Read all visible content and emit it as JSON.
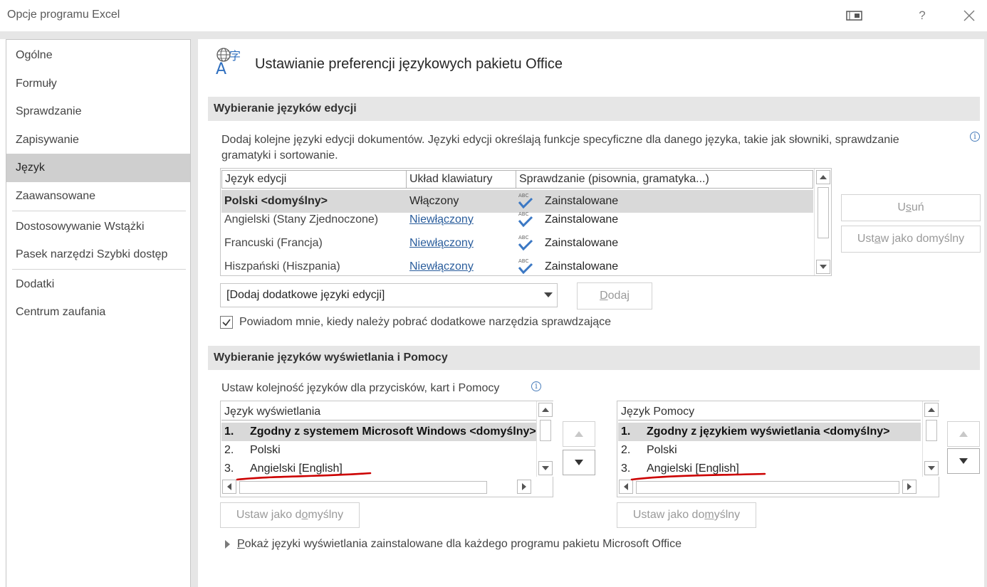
{
  "window": {
    "title": "Opcje programu Excel",
    "help_label": "?",
    "restore_icon": "restore-window-icon",
    "close_icon": "close-icon"
  },
  "sidebar": {
    "items": [
      {
        "label": "Ogólne"
      },
      {
        "label": "Formuły"
      },
      {
        "label": "Sprawdzanie"
      },
      {
        "label": "Zapisywanie"
      },
      {
        "label": "Język",
        "active": true
      },
      {
        "label": "Zaawansowane"
      },
      {
        "label": "Dostosowywanie Wstążki"
      },
      {
        "label": "Pasek narzędzi Szybki dostęp"
      },
      {
        "label": "Dodatki"
      },
      {
        "label": "Centrum zaufania"
      }
    ]
  },
  "header": {
    "title": "Ustawianie preferencji językowych pakietu Office",
    "icon": "language-icon",
    "icon_glyph_letter": "A",
    "icon_glyph_cjk": "字"
  },
  "editing": {
    "section_title": "Wybieranie języków edycji",
    "description": "Dodaj kolejne języki edycji dokumentów. Języki edycji określają funkcje specyficzne dla danego języka, takie jak słowniki, sprawdzanie gramatyki i sortowanie.",
    "info_label": "i",
    "columns": [
      "Język edycji",
      "Układ klawiatury",
      "Sprawdzanie (pisownia, gramatyka...)"
    ],
    "rows": [
      {
        "language": "Polski <domyślny>",
        "keyboard": "Włączony",
        "proofing": "Zainstalowane",
        "selected": true
      },
      {
        "language": "Angielski (Stany Zjednoczone)",
        "keyboard": "Niewłączony",
        "proofing": "Zainstalowane"
      },
      {
        "language": "Francuski (Francja)",
        "keyboard": "Niewłączony",
        "proofing": "Zainstalowane"
      },
      {
        "language": "Hiszpański (Hiszpania)",
        "keyboard": "Niewłączony",
        "proofing": "Zainstalowane"
      }
    ],
    "proofing_icon_label": "ABC",
    "remove_button": {
      "before": "U",
      "accel": "s",
      "after": "uń"
    },
    "set_default_button": {
      "before": "Ust",
      "accel": "a",
      "after": "w jako domyślny"
    },
    "add_dropdown": "[Dodaj dodatkowe języki edycji]",
    "add_button": {
      "before": "",
      "accel": "D",
      "after": "odaj"
    },
    "notify_label": "Powiadom mnie, kiedy należy pobrać dodatkowe narzędzia sprawdzające",
    "notify_checked": true
  },
  "display": {
    "section_title": "Wybieranie języków wyświetlania i Pomocy",
    "instruction": "Ustaw kolejność języków dla przycisków, kart i Pomocy",
    "info_label": "i",
    "display_list": {
      "header": "Język wyświetlania",
      "items": [
        {
          "num": "1.",
          "text": "Zgodny z systemem Microsoft Windows <domyślny>",
          "selected": true
        },
        {
          "num": "2.",
          "text": "Polski"
        },
        {
          "num": "3.",
          "text": "Angielski [English]"
        }
      ],
      "set_default": {
        "before": "Ustaw jako d",
        "accel": "o",
        "after": "myślny"
      }
    },
    "help_list": {
      "header": "Język Pomocy",
      "items": [
        {
          "num": "1.",
          "text": "Zgodny z językiem wyświetlania <domyślny>",
          "selected": true
        },
        {
          "num": "2.",
          "text": "Polski"
        },
        {
          "num": "3.",
          "text": "Angielski [English]"
        }
      ],
      "set_default": {
        "before": "Ustaw jako do",
        "accel": "m",
        "after": "yślny"
      }
    },
    "show_languages": {
      "before": "",
      "accel": "P",
      "after": "okaż języki wyświetlania zainstalowane dla każdego programu pakietu Microsoft Office"
    }
  },
  "colors": {
    "annotation": "#cc0000",
    "link": "#2a5d9c",
    "check_blue": "#3b78c4"
  }
}
